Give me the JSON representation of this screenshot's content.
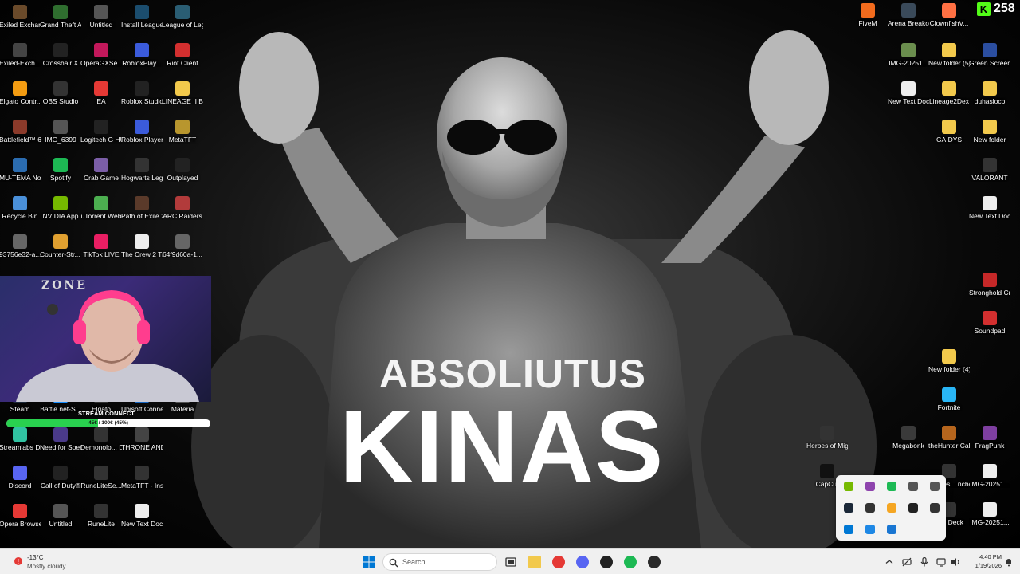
{
  "wallpaper": {
    "line1": "ABSOLIUTUS",
    "line2": "KINAS"
  },
  "desktop_left": [
    {
      "label": "Exiled Exchange 2",
      "icon": "exiled-exchange-icon",
      "color": "#6a4a2a"
    },
    {
      "label": "Grand Theft Auto V Le...",
      "icon": "gta-icon",
      "color": "#2f6e2f"
    },
    {
      "label": "Untitled",
      "icon": "file-icon",
      "color": "#555"
    },
    {
      "label": "Install League of Legends ...",
      "icon": "league-installer-icon",
      "color": "#1b4d6e"
    },
    {
      "label": "League of Legends",
      "icon": "league-icon",
      "color": "#2a5d73"
    },
    {
      "label": "Exiled-Exch...",
      "icon": "exiled-exchange-icon",
      "color": "#444"
    },
    {
      "label": "Crosshair X",
      "icon": "crosshair-icon",
      "color": "#222"
    },
    {
      "label": "OperaGXSe...",
      "icon": "opera-gx-icon",
      "color": "#c2185b"
    },
    {
      "label": "RobloxPlay...",
      "icon": "roblox-icon",
      "color": "#3b5bdb"
    },
    {
      "label": "Riot Client",
      "icon": "riot-icon",
      "color": "#d32f2f"
    },
    {
      "label": "Elgato Contr...",
      "icon": "elgato-icon",
      "color": "#f39c12"
    },
    {
      "label": "OBS Studio",
      "icon": "obs-icon",
      "color": "#333"
    },
    {
      "label": "EA",
      "icon": "ea-icon",
      "color": "#e53935"
    },
    {
      "label": "Roblox Studio",
      "icon": "roblox-studio-icon",
      "color": "#222"
    },
    {
      "label": "LINEAGE II BOHPTS",
      "icon": "folder-icon",
      "color": "#f2c94c"
    },
    {
      "label": "Battlefield™ 6",
      "icon": "battlefield-icon",
      "color": "#8b3a2a"
    },
    {
      "label": "IMG_6399",
      "icon": "image-icon",
      "color": "#555"
    },
    {
      "label": "Logitech G HUB",
      "icon": "logitech-icon",
      "color": "#222"
    },
    {
      "label": "Roblox Player",
      "icon": "roblox-icon",
      "color": "#3b5bdb"
    },
    {
      "label": "MetaTFT",
      "icon": "metatft-icon",
      "color": "#b8962e"
    },
    {
      "label": "MU-TEMA Nostalgija",
      "icon": "mu-icon",
      "color": "#2b6cb0"
    },
    {
      "label": "Spotify",
      "icon": "spotify-icon",
      "color": "#1db954"
    },
    {
      "label": "Crab Game",
      "icon": "crab-game-icon",
      "color": "#7b5ea7"
    },
    {
      "label": "Hogwarts Legacy",
      "icon": "hogwarts-icon",
      "color": "#333"
    },
    {
      "label": "Outplayed",
      "icon": "outplayed-icon",
      "color": "#222"
    },
    {
      "label": "Recycle Bin",
      "icon": "recycle-bin-icon",
      "color": "#4a90d9"
    },
    {
      "label": "NVIDIA App",
      "icon": "nvidia-icon",
      "color": "#76b900"
    },
    {
      "label": "uTorrent Web",
      "icon": "utorrent-icon",
      "color": "#4caf50"
    },
    {
      "label": "Path of Exile 2",
      "icon": "poe2-icon",
      "color": "#5a3a2a"
    },
    {
      "label": "ARC Raiders",
      "icon": "arc-raiders-icon",
      "color": "#b23b3b"
    },
    {
      "label": "93756e32-a...",
      "icon": "file-icon",
      "color": "#666"
    },
    {
      "label": "Counter-Str... 2",
      "icon": "cs2-icon",
      "color": "#e0a030"
    },
    {
      "label": "TikTok LIVE",
      "icon": "tiktok-icon",
      "color": "#e91e63"
    },
    {
      "label": "The Crew 2 Trial",
      "icon": "file-icon",
      "color": "#eee"
    },
    {
      "label": "64f9d60a-1...",
      "icon": "file-icon",
      "color": "#666"
    }
  ],
  "desktop_bottom_left": [
    {
      "label": "Steam",
      "icon": "steam-icon",
      "color": "#1b2838"
    },
    {
      "label": "Battle.net-S...",
      "icon": "battlenet-icon",
      "color": "#148eff"
    },
    {
      "label": "Elgato",
      "icon": "elgato-icon",
      "color": "#333"
    },
    {
      "label": "Ubisoft Connect",
      "icon": "ubisoft-icon",
      "color": "#1565c0"
    },
    {
      "label": "Materia",
      "icon": "file-icon",
      "color": "#555"
    },
    {
      "label": "Streamlabs Desktop",
      "icon": "streamlabs-icon",
      "color": "#31c3a2"
    },
    {
      "label": "Need for Speed™ Heat",
      "icon": "nfs-icon",
      "color": "#4a3a8a"
    },
    {
      "label": "Demonolo... Demo",
      "icon": "demonologist-icon",
      "color": "#333"
    },
    {
      "label": "THRONE AND LIBERTY",
      "icon": "tl-icon",
      "color": "#444"
    },
    {
      "label": "Discord",
      "icon": "discord-icon",
      "color": "#5865f2"
    },
    {
      "label": "Call of Duty®",
      "icon": "cod-icon",
      "color": "#222"
    },
    {
      "label": "RuneLiteSe...",
      "icon": "runelite-icon",
      "color": "#333"
    },
    {
      "label": "MetaTFT - Installer",
      "icon": "metatft-icon",
      "color": "#333"
    },
    {
      "label": "Opera Browser",
      "icon": "opera-icon",
      "color": "#e53935"
    },
    {
      "label": "Untitled",
      "icon": "file-icon",
      "color": "#555"
    },
    {
      "label": "RuneLite",
      "icon": "runelite-icon",
      "color": "#333"
    },
    {
      "label": "New Text Docume...",
      "icon": "text-file-icon",
      "color": "#eee"
    }
  ],
  "desktop_right": [
    {
      "label": "FiveM",
      "icon": "fivem-icon",
      "color": "#f26b1d"
    },
    {
      "label": "Arena Breako...",
      "icon": "arena-breakout-icon",
      "color": "#3a4a5a"
    },
    {
      "label": "ClownfishV...",
      "icon": "clownfish-icon",
      "color": "#ff7043"
    },
    {
      "label": "IMG-20251...",
      "icon": "image-icon",
      "color": "#6b8e4e"
    },
    {
      "label": "New folder (5)",
      "icon": "folder-icon",
      "color": "#f2c94c"
    },
    {
      "label": "Green Screen",
      "icon": "folder-icon",
      "color": "#2b4ea0"
    },
    {
      "label": "New Text Document",
      "icon": "text-file-icon",
      "color": "#eee"
    },
    {
      "label": "Lineage2Dex",
      "icon": "folder-icon",
      "color": "#f2c94c"
    },
    {
      "label": "duhasloco",
      "icon": "folder-icon",
      "color": "#f2c94c"
    },
    {
      "label": "GAIDYS",
      "icon": "folder-icon",
      "color": "#f2c94c"
    },
    {
      "label": "New folder",
      "icon": "folder-icon",
      "color": "#f2c94c"
    },
    {
      "label": "VALORANT",
      "icon": "valorant-icon",
      "color": "#333"
    },
    {
      "label": "New Text Docume...",
      "icon": "text-file-icon",
      "color": "#eee"
    },
    {
      "label": "Stronghold Crusader ...",
      "icon": "stronghold-icon",
      "color": "#c62828"
    },
    {
      "label": "Soundpad",
      "icon": "soundpad-icon",
      "color": "#d32f2f"
    },
    {
      "label": "New folder (4)",
      "icon": "folder-icon",
      "color": "#f2c94c"
    },
    {
      "label": "Fortnite",
      "icon": "fortnite-icon",
      "color": "#29b6f6"
    },
    {
      "label": "Heroes of Might & ...",
      "icon": "heroes-icon",
      "color": "#333"
    },
    {
      "label": "Megabonk",
      "icon": "megabonk-icon",
      "color": "#3a3a3a"
    },
    {
      "label": "theHunter Call of t...",
      "icon": "thehunter-icon",
      "color": "#b5651d"
    },
    {
      "label": "FragPunk",
      "icon": "fragpunk-icon",
      "color": "#7e3fa0"
    },
    {
      "label": "CapCut",
      "icon": "capcut-icon",
      "color": "#111"
    },
    {
      "label": "Games ...ncher",
      "icon": "games-launcher-icon",
      "color": "#333"
    },
    {
      "label": "IMG-20251...",
      "icon": "image-icon",
      "color": "#eee"
    },
    {
      "label": "...m Deck",
      "icon": "steam-deck-icon",
      "color": "#333"
    },
    {
      "label": "IMG-20251...",
      "icon": "image-icon",
      "color": "#eee"
    }
  ],
  "webcam": {
    "zone_text": "ZONE"
  },
  "stream_overlay": {
    "connect_label": "STREAM CONNECT",
    "goal_text": "45€ / 100€ (45%)",
    "goal_progress": 0.45
  },
  "kick": {
    "letter": "K",
    "viewer_count": "258"
  },
  "tray_overflow": [
    {
      "icon": "nvidia-tray-icon",
      "color": "#76b900"
    },
    {
      "icon": "elgato-tray-icon",
      "color": "#8e44ad"
    },
    {
      "icon": "spotify-tray-icon",
      "color": "#1db954"
    },
    {
      "icon": "obs-tray-icon",
      "color": "#555"
    },
    {
      "icon": "controller-tray-icon",
      "color": "#555"
    },
    {
      "icon": "steam-tray-icon",
      "color": "#1b2838"
    },
    {
      "icon": "razer-tray-icon",
      "color": "#333"
    },
    {
      "icon": "norton-tray-icon",
      "color": "#f5a623"
    },
    {
      "icon": "logitech-tray-icon",
      "color": "#222"
    },
    {
      "icon": "riot-tray-icon",
      "color": "#333"
    },
    {
      "icon": "onedrive-tray-icon",
      "color": "#0078d4"
    },
    {
      "icon": "defender-tray-icon",
      "color": "#1e88e5"
    },
    {
      "icon": "bluetooth-tray-icon",
      "color": "#1976d2"
    }
  ],
  "taskbar": {
    "weather_temp": "-13°C",
    "weather_desc": "Mostly cloudy",
    "search_placeholder": "Search",
    "time": "4:40 PM",
    "date": "1/19/2026",
    "pinned": [
      {
        "name": "file-explorer-icon",
        "color": "#f2c94c"
      },
      {
        "name": "opera-icon",
        "color": "#e53935"
      },
      {
        "name": "discord-icon",
        "color": "#5865f2"
      },
      {
        "name": "obs-icon",
        "color": "#222"
      },
      {
        "name": "spotify-icon",
        "color": "#1db954"
      },
      {
        "name": "kick-icon",
        "color": "#2a2a2a"
      }
    ]
  }
}
